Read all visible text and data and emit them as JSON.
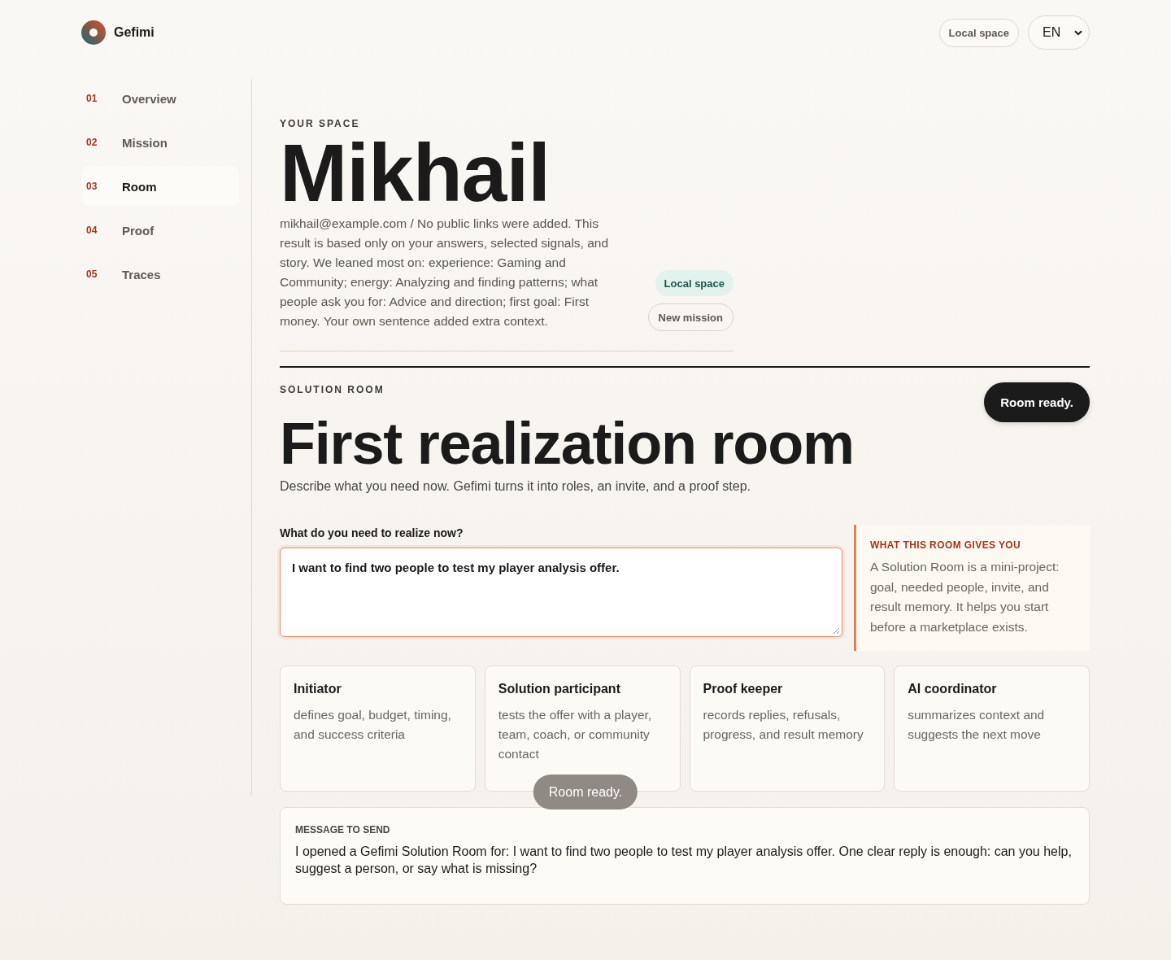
{
  "header": {
    "brand": "Gefimi",
    "space_badge": "Local space",
    "language": {
      "value": "EN"
    }
  },
  "sidebar": {
    "items": [
      {
        "number": "01",
        "label": "Overview",
        "selected": false
      },
      {
        "number": "02",
        "label": "Mission",
        "selected": false
      },
      {
        "number": "03",
        "label": "Room",
        "selected": true
      },
      {
        "number": "04",
        "label": "Proof",
        "selected": false
      },
      {
        "number": "05",
        "label": "Traces",
        "selected": false
      }
    ]
  },
  "profile": {
    "eyebrow": "YOUR SPACE",
    "name": "Mikhail",
    "summary": "mikhail@example.com / No public links were added. This result is based only on your answers, selected signals, and story. We leaned most on: experience: Gaming and Community; energy: Analyzing and finding patterns; what people ask you for: Advice and direction; first goal: First money. Your own sentence added extra context.",
    "badges": [
      {
        "kind": "tag",
        "label": "Local space"
      },
      {
        "kind": "button",
        "label": "New mission"
      }
    ]
  },
  "room": {
    "eyebrow": "SOLUTION ROOM",
    "status": "Room ready.",
    "title": "First realization room",
    "description": "Describe what you need now. Gefimi turns it into roles, an invite, and a proof step.",
    "prompt": {
      "label": "What do you need to realize now?",
      "value": "I want to find two people to test my player analysis offer."
    },
    "aside": {
      "title": "WHAT THIS ROOM GIVES YOU",
      "text": "A Solution Room is a mini-project: goal, needed people, invite, and result memory. It helps you start before a marketplace exists."
    },
    "roles": [
      {
        "title": "Initiator",
        "text": "defines goal, budget, timing, and success criteria"
      },
      {
        "title": "Solution participant",
        "text": "tests the offer with a player, team, coach, or community contact"
      },
      {
        "title": "Proof keeper",
        "text": "records replies, refusals, progress, and result memory"
      },
      {
        "title": "AI coordinator",
        "text": "summarizes context and suggests the next move"
      }
    ],
    "message": {
      "title": "MESSAGE TO SEND",
      "text": "I opened a Gefimi Solution Room for: I want to find two people to test my player analysis offer. One clear reply is enough: can you help, suggest a person, or say what is missing?"
    }
  },
  "toast": {
    "text": "Room ready."
  }
}
